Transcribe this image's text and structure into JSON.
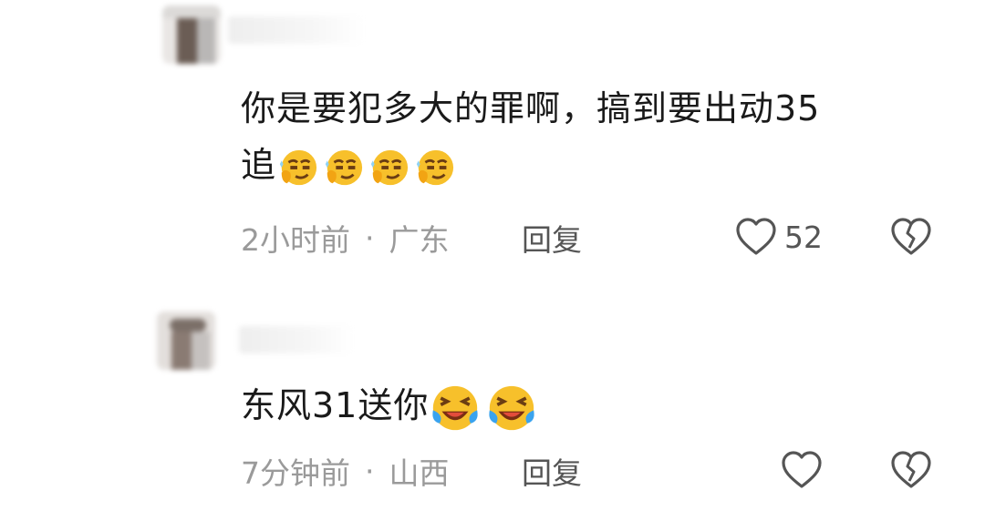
{
  "comments": [
    {
      "text_line1": "你是要犯多大的罪啊，搞到要出动35",
      "text_line2": "追",
      "emoji": "smirk-emoji",
      "emoji_count": 4,
      "time": "2小时前",
      "separator": "·",
      "location": "广东",
      "reply_label": "回复",
      "like_count": "52"
    },
    {
      "text_line1": "东风31送你",
      "emoji": "laugh-cry-emoji",
      "emoji_count": 2,
      "time": "7分钟前",
      "separator": "·",
      "location": "山西",
      "reply_label": "回复"
    }
  ],
  "colors": {
    "text": "#1a1a1a",
    "meta": "#9a9a9a",
    "action": "#555555",
    "emoji_face": "#f7c02b"
  }
}
